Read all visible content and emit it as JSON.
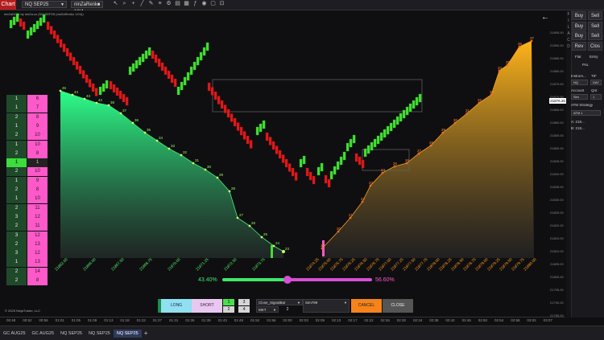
{
  "topbar": {
    "title": "Chart",
    "instrument": "NQ SEP25",
    "bar_type": "ninZaRenko 12/4",
    "icons": [
      "cursor-icon",
      "magnify-icon",
      "crosshair-icon",
      "line-tool-icon",
      "draw-icon",
      "properties-icon",
      "strategy-icon",
      "chart-trader-icon",
      "data-box-icon",
      "indicator-icon",
      "camera-icon",
      "screen-icon",
      "attach-icon"
    ]
  },
  "chart": {
    "header": "ninZaDOM by ninZa.co (NQ SEP25 (ninZaRenko 12/4))",
    "copyright": "© 2025 NinjaTrader, LLC",
    "price_labels": [
      "21895.00",
      "21890.00",
      "21885.00",
      "21880.00",
      "21875.00",
      "21870.00",
      "21865.00",
      "21860.00",
      "21855.00",
      "21850.00",
      "21845.00",
      "21840.00",
      "21835.00",
      "21830.00",
      "21825.00",
      "21820.00",
      "21815.00",
      "21810.00",
      "21805.00",
      "21800.00",
      "21795.00",
      "21790.00",
      "21785.00"
    ],
    "current_price": "21876.25",
    "time_labels": [
      "00:48",
      "00:52",
      "00:56",
      "01:01",
      "01:05",
      "01:09",
      "01:13",
      "01:18",
      "01:22",
      "01:27",
      "01:31",
      "01:35",
      "01:39",
      "01:43",
      "01:48",
      "01:52",
      "01:56",
      "02:00",
      "02:03",
      "02:09",
      "02:13",
      "02:17",
      "02:22",
      "02:26",
      "02:30",
      "02:34",
      "02:38",
      "02:42",
      "02:46",
      "02:50",
      "02:54",
      "02:58",
      "03:02",
      "03:07"
    ],
    "bid_counts": [
      "45",
      "44",
      "43",
      "42",
      "38",
      "37",
      "36",
      "35",
      "34",
      "33",
      "32",
      "31",
      "30",
      "29",
      "28",
      "27",
      "26",
      "25",
      "24",
      "23",
      "22",
      "21",
      "20",
      "19",
      "18",
      "17",
      "16",
      "15",
      "14",
      "13",
      "12",
      "11",
      "10",
      "9",
      "8",
      "7",
      "6",
      "5",
      "4",
      "3",
      "2",
      "1"
    ],
    "ask_counts": [
      "1",
      "2",
      "3",
      "4",
      "5",
      "6",
      "7",
      "8",
      "9",
      "10",
      "11",
      "12",
      "13",
      "14",
      "15",
      "16",
      "17",
      "18",
      "19",
      "20",
      "21",
      "22",
      "23",
      "24",
      "25",
      "26",
      "27",
      "28",
      "29",
      "30",
      "31",
      "32",
      "33",
      "34",
      "35",
      "36",
      "37",
      "38",
      "39",
      "40",
      "41",
      "42",
      "43",
      "44",
      "45",
      "46",
      "47",
      "48",
      "49",
      "50"
    ],
    "left_price_labels": [
      "21862.00",
      "21866.00",
      "21867.50",
      "21868.75",
      "21870.00",
      "21871.25",
      "21872.50",
      "21873.75"
    ],
    "right_price_labels": [
      "21874.25",
      "21875.00",
      "21875.75",
      "21876.25",
      "21876.50",
      "21876.75",
      "21877.00",
      "21877.25",
      "21877.50",
      "21877.75",
      "21878.00",
      "21878.25",
      "21878.50",
      "21878.75",
      "21879.00",
      "21879.25",
      "21879.50",
      "21879.75",
      "21880.00"
    ]
  },
  "dom_table": {
    "rows": [
      {
        "left": "1",
        "right": "6"
      },
      {
        "left": "1",
        "right": "7"
      },
      {
        "left": "2",
        "right": "8"
      },
      {
        "left": "1",
        "right": "9"
      },
      {
        "left": "2",
        "right": "10"
      },
      {
        "left": "1",
        "right": "10"
      },
      {
        "left": "2",
        "right": "8"
      },
      {
        "left": "1",
        "right": "1",
        "highlight": true
      },
      {
        "left": "2",
        "right": "10"
      },
      {
        "left": "1",
        "right": "9"
      },
      {
        "left": "2",
        "right": "8"
      },
      {
        "left": "1",
        "right": "10"
      },
      {
        "left": "2",
        "right": "11"
      },
      {
        "left": "3",
        "right": "12"
      },
      {
        "left": "2",
        "right": "11"
      },
      {
        "left": "3",
        "right": "12"
      },
      {
        "left": "2",
        "right": "13"
      },
      {
        "left": "3",
        "right": "12"
      },
      {
        "left": "1",
        "right": "13"
      },
      {
        "left": "2",
        "right": "14"
      },
      {
        "left": "2",
        "right": "8"
      }
    ]
  },
  "balance": {
    "left_pct": "43.40%",
    "right_pct": "56.60%",
    "buy_fraction": 0.434
  },
  "controls": {
    "long": "LONG",
    "short": "SHORT",
    "qty": [
      "1",
      "3",
      "2",
      "4"
    ],
    "order_type": "Close_SignalBar",
    "market": "MKT",
    "market_qty": "2",
    "account": "Sim789",
    "cancel": "CANCEL",
    "close": "CLOSE"
  },
  "right_panel": {
    "strip": [
      "F",
      "I",
      "L",
      "A",
      "C",
      "D"
    ],
    "buttons": [
      [
        "Buy",
        "Sell"
      ],
      [
        "Buy",
        "Sell"
      ],
      [
        "Buy",
        "Sell"
      ],
      [
        "Rev",
        "Clos"
      ]
    ],
    "flat": "Flat",
    "entry": "Entry",
    "pnl": "PnL",
    "instrument_label": "Instrum...",
    "tif_label": "TIF",
    "instrument_value": "NQ",
    "tif_value": "DAY",
    "account_label": "Account",
    "qty_label": "Qnt",
    "account_value": "Sim",
    "qty_value": "1",
    "atm_label": "ATM Strategy",
    "atm_value": "ATM 1",
    "a_label": "A: 218...",
    "b_label": "B: 218..."
  },
  "tabs": [
    {
      "label": "GC AUG25",
      "active": false
    },
    {
      "label": "GC AUG25",
      "active": false
    },
    {
      "label": "NQ SEP25",
      "active": false
    },
    {
      "label": "NQ SEP25",
      "active": false
    },
    {
      "label": "NQ SEP25",
      "active": true
    }
  ]
}
